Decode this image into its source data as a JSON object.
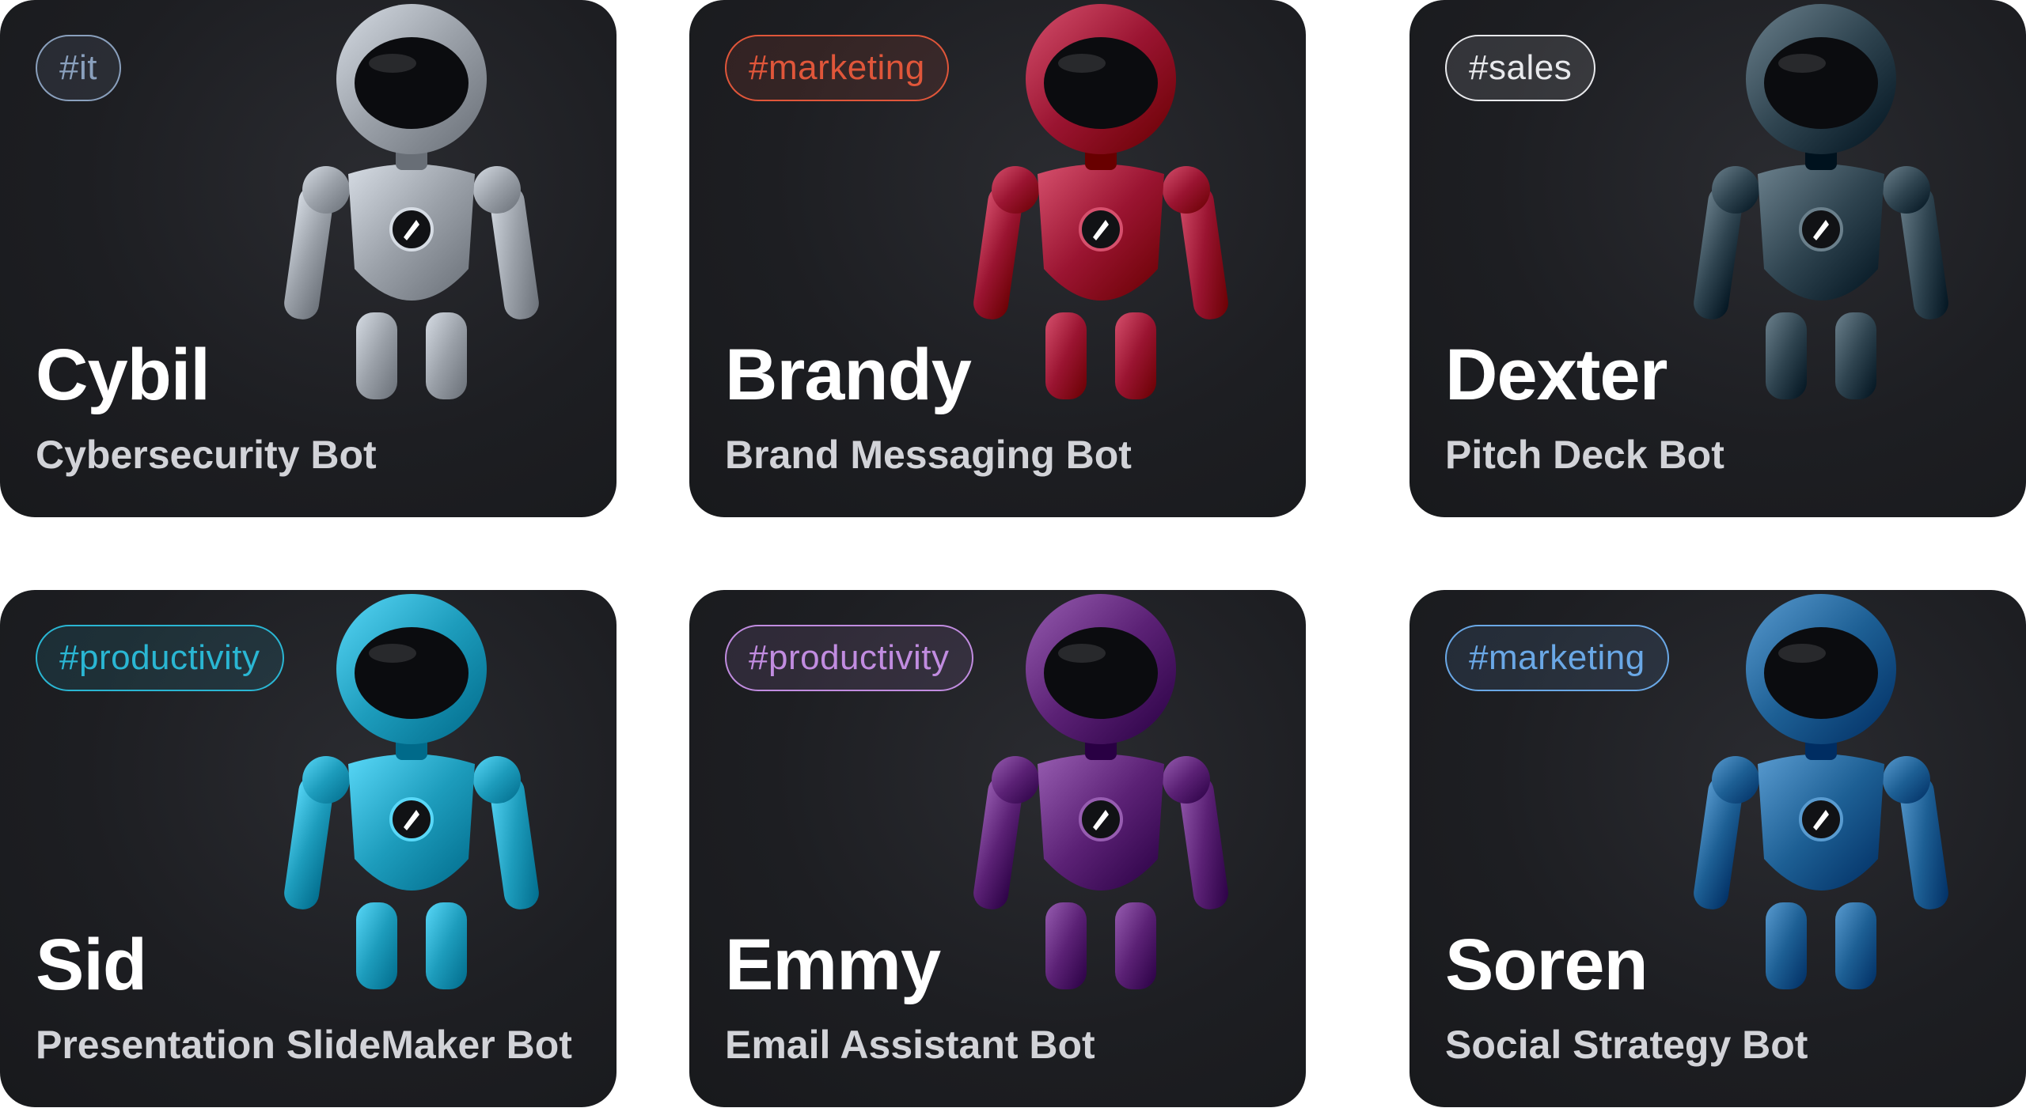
{
  "cards": [
    {
      "tag": "#it",
      "name": "Cybil",
      "role": "Cybersecurity Bot",
      "tag_color": "#8aa0bd",
      "robot_color": "#9aa0a8",
      "robot_icon": "compass-icon"
    },
    {
      "tag": "#marketing",
      "name": "Brandy",
      "role": "Brand Messaging Bot",
      "tag_color": "#e0563a",
      "robot_color": "#9a1431",
      "robot_icon": "compass-icon"
    },
    {
      "tag": "#sales",
      "name": "Dexter",
      "role": "Pitch Deck Bot",
      "tag_color": "#e8e9ec",
      "robot_color": "#2f4450",
      "robot_icon": "compass-icon"
    },
    {
      "tag": "#productivity",
      "name": "Sid",
      "role": "Presentation SlideMaker Bot",
      "tag_color": "#2ab6d3",
      "robot_color": "#1d9cbc",
      "robot_icon": "compass-icon"
    },
    {
      "tag": "#productivity",
      "name": "Emmy",
      "role": "Email Assistant Bot",
      "tag_color": "#c18ce0",
      "robot_color": "#5b2175",
      "robot_icon": "envelope-icon"
    },
    {
      "tag": "#marketing",
      "name": "Soren",
      "role": "Social Strategy Bot",
      "tag_color": "#6aa8e6",
      "robot_color": "#1d5f94",
      "robot_icon": "compass-icon"
    }
  ]
}
